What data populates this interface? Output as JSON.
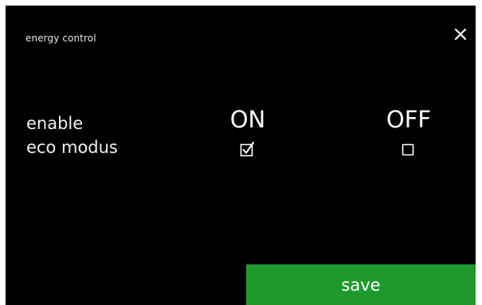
{
  "header": {
    "title": "energy control",
    "close_icon": "close-icon"
  },
  "setting": {
    "label_line1": "enable",
    "label_line2": "eco modus",
    "options": [
      {
        "label": "ON",
        "checked": true
      },
      {
        "label": "OFF",
        "checked": false
      }
    ]
  },
  "footer": {
    "save_label": "save"
  },
  "colors": {
    "background": "#000000",
    "accent": "#1e9a2c",
    "text": "#ffffff"
  }
}
